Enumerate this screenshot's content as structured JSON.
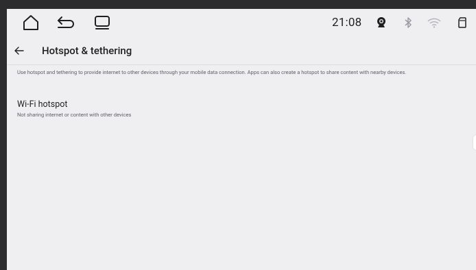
{
  "status_bar": {
    "time": "21:08",
    "icons": [
      "camera-icon",
      "bluetooth-icon",
      "wifi-icon",
      "sd-card-icon"
    ]
  },
  "nav_bar": {
    "buttons": [
      "home-icon",
      "back-icon",
      "recents-icon"
    ]
  },
  "app_bar": {
    "title": "Hotspot & tethering"
  },
  "description": "Use hotspot and tethering to provide internet to other devices through your mobile data connection. Apps can also create a hotspot to share content with nearby devices.",
  "items": [
    {
      "title": "Wi-Fi hotspot",
      "summary": "Not sharing internet or content with other devices"
    }
  ],
  "colors": {
    "background": "#efeff1",
    "frame": "#2c2c2e",
    "text_primary": "#1f1f1f",
    "text_secondary": "#5f6066"
  }
}
